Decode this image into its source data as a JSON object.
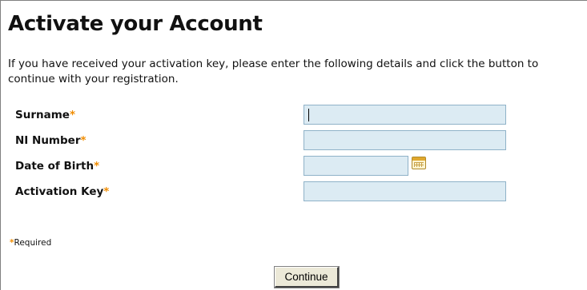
{
  "page": {
    "title": "Activate your Account",
    "intro": "If you have received your activation key, please enter the following details and click the button to continue with your registration."
  },
  "form": {
    "fields": [
      {
        "label": "Surname",
        "value": ""
      },
      {
        "label": "NI Number",
        "value": ""
      },
      {
        "label": "Date of Birth",
        "value": ""
      },
      {
        "label": "Activation Key",
        "value": ""
      }
    ],
    "required_mark": "*",
    "required_note": "Required"
  },
  "buttons": {
    "continue_label": "Continue"
  },
  "icons": {
    "date_picker": "calendar-icon"
  },
  "colors": {
    "required_star": "#f08c00",
    "input_background": "#dcebf3",
    "input_border": "#8fb2c8"
  }
}
